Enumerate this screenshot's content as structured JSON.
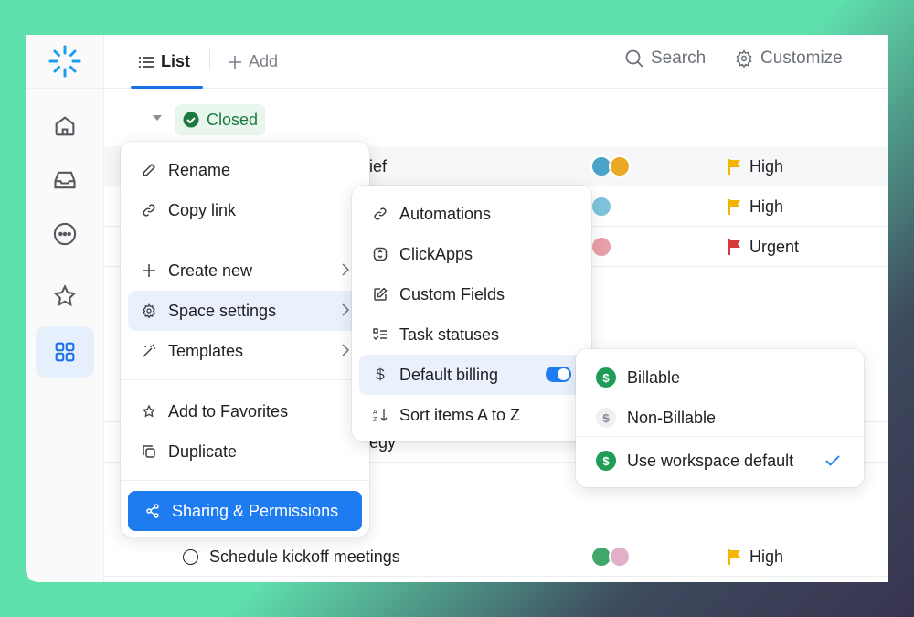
{
  "colors": {
    "accent": "#1e7bf0",
    "closed_green": "#1d7a3e",
    "billable_green": "#1f9d57",
    "flag_high": "#f5b400",
    "flag_urgent": "#d33a3a"
  },
  "header": {
    "tabs": [
      {
        "label": "List",
        "icon": "list-icon"
      },
      {
        "label": "Add",
        "icon": "plus-icon"
      }
    ],
    "search_label": "Search",
    "customize_label": "Customize"
  },
  "sidebar": {
    "items": [
      {
        "icon": "home-icon"
      },
      {
        "icon": "inbox-icon"
      },
      {
        "icon": "more-icon"
      },
      {
        "icon": "star-icon"
      },
      {
        "icon": "grid-icon",
        "active": true
      }
    ]
  },
  "group": {
    "status": "Closed"
  },
  "tasks": [
    {
      "name_fragment": "ief",
      "priority": "High"
    },
    {
      "name_fragment": "",
      "priority": "High"
    },
    {
      "name_fragment": "",
      "priority": "Urgent"
    },
    {
      "name_fragment": "egy",
      "priority": ""
    },
    {
      "name": "Schedule kickoff meetings",
      "priority": "High"
    }
  ],
  "context_menu": {
    "items": [
      {
        "label": "Rename",
        "icon": "pencil-icon"
      },
      {
        "label": "Copy link",
        "icon": "link-icon"
      },
      {
        "label": "Create new",
        "icon": "plus-icon",
        "submenu": true
      },
      {
        "label": "Space settings",
        "icon": "gear-icon",
        "submenu": true
      },
      {
        "label": "Templates",
        "icon": "wand-icon",
        "submenu": true
      },
      {
        "label": "Add to Favorites",
        "icon": "star-icon"
      },
      {
        "label": "Duplicate",
        "icon": "duplicate-icon"
      }
    ],
    "primary": "Sharing & Permissions"
  },
  "settings_menu": {
    "items": [
      {
        "label": "Automations",
        "icon": "link-icon"
      },
      {
        "label": "ClickApps",
        "icon": "clickapps-icon"
      },
      {
        "label": "Custom Fields",
        "icon": "edit-icon"
      },
      {
        "label": "Task statuses",
        "icon": "checklist-icon"
      },
      {
        "label": "Default billing",
        "icon": "dollar-icon",
        "toggle_on": true
      },
      {
        "label": "Sort items A to Z",
        "icon": "sort-icon"
      }
    ]
  },
  "billing_menu": {
    "items": [
      {
        "label": "Billable",
        "icon": "dollar-icon"
      },
      {
        "label": "Non-Billable",
        "icon": "no-dollar-icon"
      },
      {
        "label": "Use workspace default",
        "icon": "dollar-icon",
        "selected": true
      }
    ]
  }
}
